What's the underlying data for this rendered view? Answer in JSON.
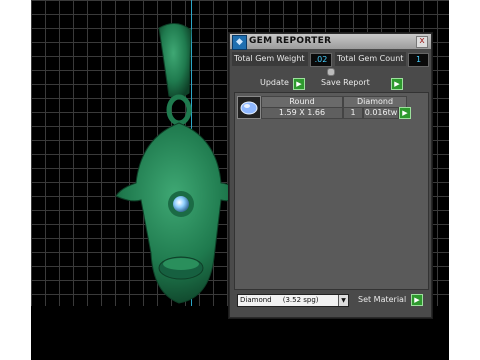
{
  "window": {
    "title": "GEM REPORTER",
    "close_glyph": "x",
    "logo_glyph": "◆"
  },
  "totals": {
    "weight_label": "Total Gem Weight",
    "weight_value": ".02",
    "count_label": "Total Gem Count",
    "count_value": "1"
  },
  "actions": {
    "update_label": "Update",
    "save_report_label": "Save Report",
    "go_glyph": "▶"
  },
  "table": {
    "headers": [
      "Round",
      "Diamond"
    ],
    "rows": [
      {
        "size": "1.59 X 1.66",
        "count": "1",
        "weight": "0.016tw"
      }
    ]
  },
  "material": {
    "selected": "Diamond     (3.52 spg)",
    "arrow_glyph": "▼",
    "set_label": "Set Material"
  },
  "colors": {
    "model": "#1f7a4e",
    "gem": "#8fd0ff",
    "accent_green": "#2e9a2e",
    "value_cyan": "#4ad0ff"
  }
}
